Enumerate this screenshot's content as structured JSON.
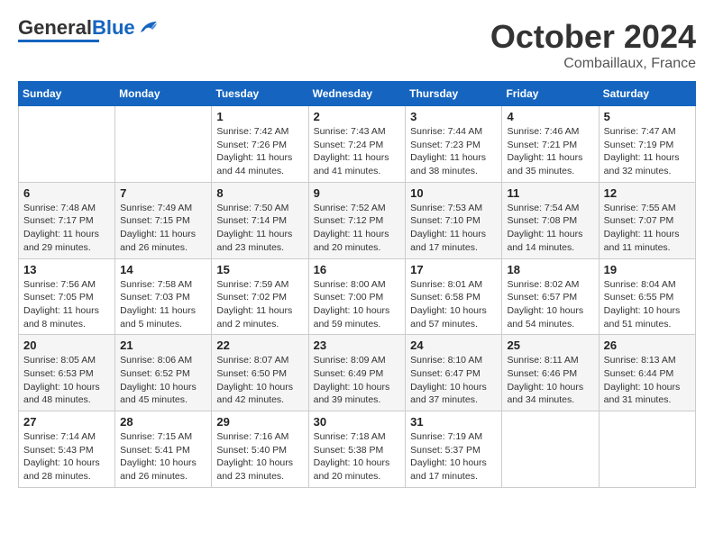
{
  "header": {
    "logo_line1": "General",
    "logo_line2": "Blue",
    "month": "October 2024",
    "location": "Combaillaux, France"
  },
  "weekdays": [
    "Sunday",
    "Monday",
    "Tuesday",
    "Wednesday",
    "Thursday",
    "Friday",
    "Saturday"
  ],
  "weeks": [
    [
      {
        "day": "",
        "sunrise": "",
        "sunset": "",
        "daylight": ""
      },
      {
        "day": "",
        "sunrise": "",
        "sunset": "",
        "daylight": ""
      },
      {
        "day": "1",
        "sunrise": "Sunrise: 7:42 AM",
        "sunset": "Sunset: 7:26 PM",
        "daylight": "Daylight: 11 hours and 44 minutes."
      },
      {
        "day": "2",
        "sunrise": "Sunrise: 7:43 AM",
        "sunset": "Sunset: 7:24 PM",
        "daylight": "Daylight: 11 hours and 41 minutes."
      },
      {
        "day": "3",
        "sunrise": "Sunrise: 7:44 AM",
        "sunset": "Sunset: 7:23 PM",
        "daylight": "Daylight: 11 hours and 38 minutes."
      },
      {
        "day": "4",
        "sunrise": "Sunrise: 7:46 AM",
        "sunset": "Sunset: 7:21 PM",
        "daylight": "Daylight: 11 hours and 35 minutes."
      },
      {
        "day": "5",
        "sunrise": "Sunrise: 7:47 AM",
        "sunset": "Sunset: 7:19 PM",
        "daylight": "Daylight: 11 hours and 32 minutes."
      }
    ],
    [
      {
        "day": "6",
        "sunrise": "Sunrise: 7:48 AM",
        "sunset": "Sunset: 7:17 PM",
        "daylight": "Daylight: 11 hours and 29 minutes."
      },
      {
        "day": "7",
        "sunrise": "Sunrise: 7:49 AM",
        "sunset": "Sunset: 7:15 PM",
        "daylight": "Daylight: 11 hours and 26 minutes."
      },
      {
        "day": "8",
        "sunrise": "Sunrise: 7:50 AM",
        "sunset": "Sunset: 7:14 PM",
        "daylight": "Daylight: 11 hours and 23 minutes."
      },
      {
        "day": "9",
        "sunrise": "Sunrise: 7:52 AM",
        "sunset": "Sunset: 7:12 PM",
        "daylight": "Daylight: 11 hours and 20 minutes."
      },
      {
        "day": "10",
        "sunrise": "Sunrise: 7:53 AM",
        "sunset": "Sunset: 7:10 PM",
        "daylight": "Daylight: 11 hours and 17 minutes."
      },
      {
        "day": "11",
        "sunrise": "Sunrise: 7:54 AM",
        "sunset": "Sunset: 7:08 PM",
        "daylight": "Daylight: 11 hours and 14 minutes."
      },
      {
        "day": "12",
        "sunrise": "Sunrise: 7:55 AM",
        "sunset": "Sunset: 7:07 PM",
        "daylight": "Daylight: 11 hours and 11 minutes."
      }
    ],
    [
      {
        "day": "13",
        "sunrise": "Sunrise: 7:56 AM",
        "sunset": "Sunset: 7:05 PM",
        "daylight": "Daylight: 11 hours and 8 minutes."
      },
      {
        "day": "14",
        "sunrise": "Sunrise: 7:58 AM",
        "sunset": "Sunset: 7:03 PM",
        "daylight": "Daylight: 11 hours and 5 minutes."
      },
      {
        "day": "15",
        "sunrise": "Sunrise: 7:59 AM",
        "sunset": "Sunset: 7:02 PM",
        "daylight": "Daylight: 11 hours and 2 minutes."
      },
      {
        "day": "16",
        "sunrise": "Sunrise: 8:00 AM",
        "sunset": "Sunset: 7:00 PM",
        "daylight": "Daylight: 10 hours and 59 minutes."
      },
      {
        "day": "17",
        "sunrise": "Sunrise: 8:01 AM",
        "sunset": "Sunset: 6:58 PM",
        "daylight": "Daylight: 10 hours and 57 minutes."
      },
      {
        "day": "18",
        "sunrise": "Sunrise: 8:02 AM",
        "sunset": "Sunset: 6:57 PM",
        "daylight": "Daylight: 10 hours and 54 minutes."
      },
      {
        "day": "19",
        "sunrise": "Sunrise: 8:04 AM",
        "sunset": "Sunset: 6:55 PM",
        "daylight": "Daylight: 10 hours and 51 minutes."
      }
    ],
    [
      {
        "day": "20",
        "sunrise": "Sunrise: 8:05 AM",
        "sunset": "Sunset: 6:53 PM",
        "daylight": "Daylight: 10 hours and 48 minutes."
      },
      {
        "day": "21",
        "sunrise": "Sunrise: 8:06 AM",
        "sunset": "Sunset: 6:52 PM",
        "daylight": "Daylight: 10 hours and 45 minutes."
      },
      {
        "day": "22",
        "sunrise": "Sunrise: 8:07 AM",
        "sunset": "Sunset: 6:50 PM",
        "daylight": "Daylight: 10 hours and 42 minutes."
      },
      {
        "day": "23",
        "sunrise": "Sunrise: 8:09 AM",
        "sunset": "Sunset: 6:49 PM",
        "daylight": "Daylight: 10 hours and 39 minutes."
      },
      {
        "day": "24",
        "sunrise": "Sunrise: 8:10 AM",
        "sunset": "Sunset: 6:47 PM",
        "daylight": "Daylight: 10 hours and 37 minutes."
      },
      {
        "day": "25",
        "sunrise": "Sunrise: 8:11 AM",
        "sunset": "Sunset: 6:46 PM",
        "daylight": "Daylight: 10 hours and 34 minutes."
      },
      {
        "day": "26",
        "sunrise": "Sunrise: 8:13 AM",
        "sunset": "Sunset: 6:44 PM",
        "daylight": "Daylight: 10 hours and 31 minutes."
      }
    ],
    [
      {
        "day": "27",
        "sunrise": "Sunrise: 7:14 AM",
        "sunset": "Sunset: 5:43 PM",
        "daylight": "Daylight: 10 hours and 28 minutes."
      },
      {
        "day": "28",
        "sunrise": "Sunrise: 7:15 AM",
        "sunset": "Sunset: 5:41 PM",
        "daylight": "Daylight: 10 hours and 26 minutes."
      },
      {
        "day": "29",
        "sunrise": "Sunrise: 7:16 AM",
        "sunset": "Sunset: 5:40 PM",
        "daylight": "Daylight: 10 hours and 23 minutes."
      },
      {
        "day": "30",
        "sunrise": "Sunrise: 7:18 AM",
        "sunset": "Sunset: 5:38 PM",
        "daylight": "Daylight: 10 hours and 20 minutes."
      },
      {
        "day": "31",
        "sunrise": "Sunrise: 7:19 AM",
        "sunset": "Sunset: 5:37 PM",
        "daylight": "Daylight: 10 hours and 17 minutes."
      },
      {
        "day": "",
        "sunrise": "",
        "sunset": "",
        "daylight": ""
      },
      {
        "day": "",
        "sunrise": "",
        "sunset": "",
        "daylight": ""
      }
    ]
  ]
}
